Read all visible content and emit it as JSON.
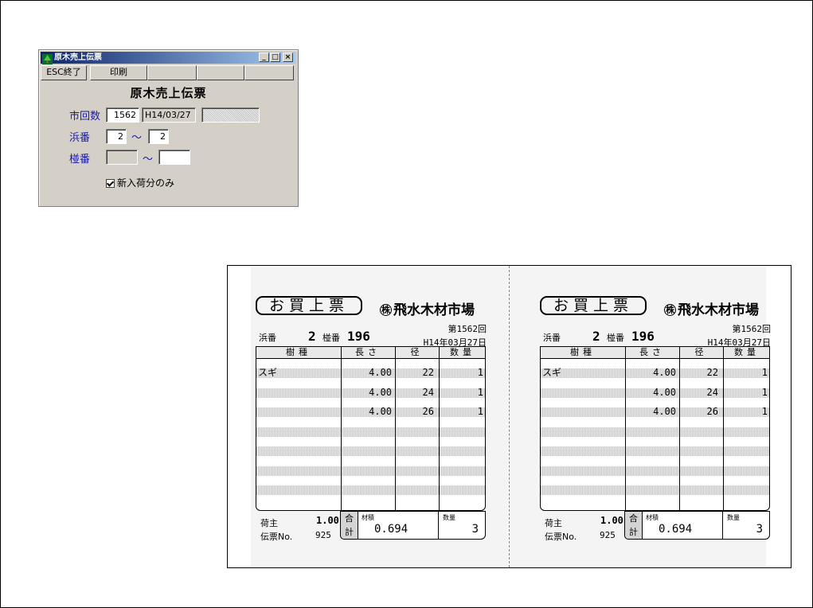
{
  "window": {
    "title": "原木売上伝票",
    "buttons": {
      "minimize": "_",
      "maximize": "□",
      "close": "×"
    }
  },
  "toolbar": {
    "esc_label": "ESC終了",
    "print_label": "印刷",
    "empty_slots": [
      "",
      "",
      ""
    ]
  },
  "dialog": {
    "heading": "原木売上伝票",
    "session_label": "市回数",
    "session_no": "1562",
    "session_date": "H14/03/27",
    "session_extra": "",
    "yard_label": "浜番",
    "yard_from": "2",
    "yard_to": "2",
    "tilde": "～",
    "bin_label": "椪番",
    "bin_from": "",
    "bin_to": "",
    "new_only_label": "新入荷分のみ",
    "new_only_checked": true
  },
  "slips": [
    {
      "badge": "お買上票",
      "company_mark": "株",
      "company": "飛水木材市場",
      "session": "第1562回",
      "yard_label": "浜番",
      "yard_no": "2",
      "bin_label": "椪番",
      "bin_no": "196",
      "date": "H14年03月27日",
      "headers": [
        "樹種",
        "長さ",
        "径",
        "数量"
      ],
      "rows": [
        {
          "species": "スギ",
          "length": "4.00",
          "diameter": "22",
          "qty": "1"
        },
        {
          "species": "",
          "length": "4.00",
          "diameter": "24",
          "qty": "1"
        },
        {
          "species": "",
          "length": "4.00",
          "diameter": "26",
          "qty": "1"
        }
      ],
      "owner_label": "荷主",
      "owner_value": "1.00",
      "slip_no_label": "伝票No.",
      "slip_no": "925",
      "total_label": "合計",
      "volume_label": "材積",
      "volume": "0.694",
      "qty_label": "数量",
      "total_qty": "3"
    },
    {
      "badge": "お買上票",
      "company_mark": "株",
      "company": "飛水木材市場",
      "session": "第1562回",
      "yard_label": "浜番",
      "yard_no": "2",
      "bin_label": "椪番",
      "bin_no": "196",
      "date": "H14年03月27日",
      "headers": [
        "樹種",
        "長さ",
        "径",
        "数量"
      ],
      "rows": [
        {
          "species": "スギ",
          "length": "4.00",
          "diameter": "22",
          "qty": "1"
        },
        {
          "species": "",
          "length": "4.00",
          "diameter": "24",
          "qty": "1"
        },
        {
          "species": "",
          "length": "4.00",
          "diameter": "26",
          "qty": "1"
        }
      ],
      "owner_label": "荷主",
      "owner_value": "1.00",
      "slip_no_label": "伝票No.",
      "slip_no": "925",
      "total_label": "合計",
      "volume_label": "材積",
      "volume": "0.694",
      "qty_label": "数量",
      "total_qty": "3"
    }
  ]
}
